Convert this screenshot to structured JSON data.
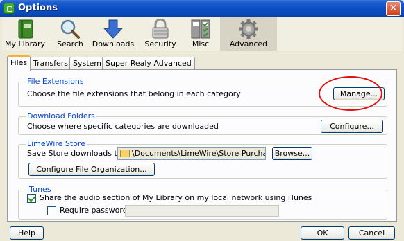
{
  "window": {
    "title": "Options"
  },
  "toolbar": {
    "items": [
      {
        "label": "My Library"
      },
      {
        "label": "Search"
      },
      {
        "label": "Downloads"
      },
      {
        "label": "Security"
      },
      {
        "label": "Misc"
      },
      {
        "label": "Advanced",
        "selected": true
      }
    ]
  },
  "tabs": [
    {
      "label": "Files",
      "selected": true
    },
    {
      "label": "Transfers"
    },
    {
      "label": "System"
    },
    {
      "label": "Super Realy Advanced"
    }
  ],
  "file_extensions": {
    "title": "File Extensions",
    "description": "Choose the file extensions that belong in each category",
    "button": "Manage..."
  },
  "download_folders": {
    "title": "Download Folders",
    "description": "Choose where specific categories are downloaded",
    "button": "Configure..."
  },
  "limewire_store": {
    "title": "LimeWire Store",
    "save_label": "Save Store downloads to:",
    "path": "\\Documents\\LimeWire\\Store Purchased",
    "browse_button": "Browse...",
    "configure_button": "Configure File Organization..."
  },
  "itunes": {
    "title": "iTunes",
    "share_label": "Share the audio section of My Library on my local network using iTunes",
    "share_checked": true,
    "password_label": "Require password",
    "password_checked": false,
    "password_value": ""
  },
  "footer": {
    "help": "Help",
    "ok": "OK",
    "cancel": "Cancel"
  },
  "colors": {
    "titlebar": "#0a4fc4",
    "group_title": "#0046d5",
    "highlight": "#e01010",
    "active_tab_accent": "#f5b03a"
  }
}
